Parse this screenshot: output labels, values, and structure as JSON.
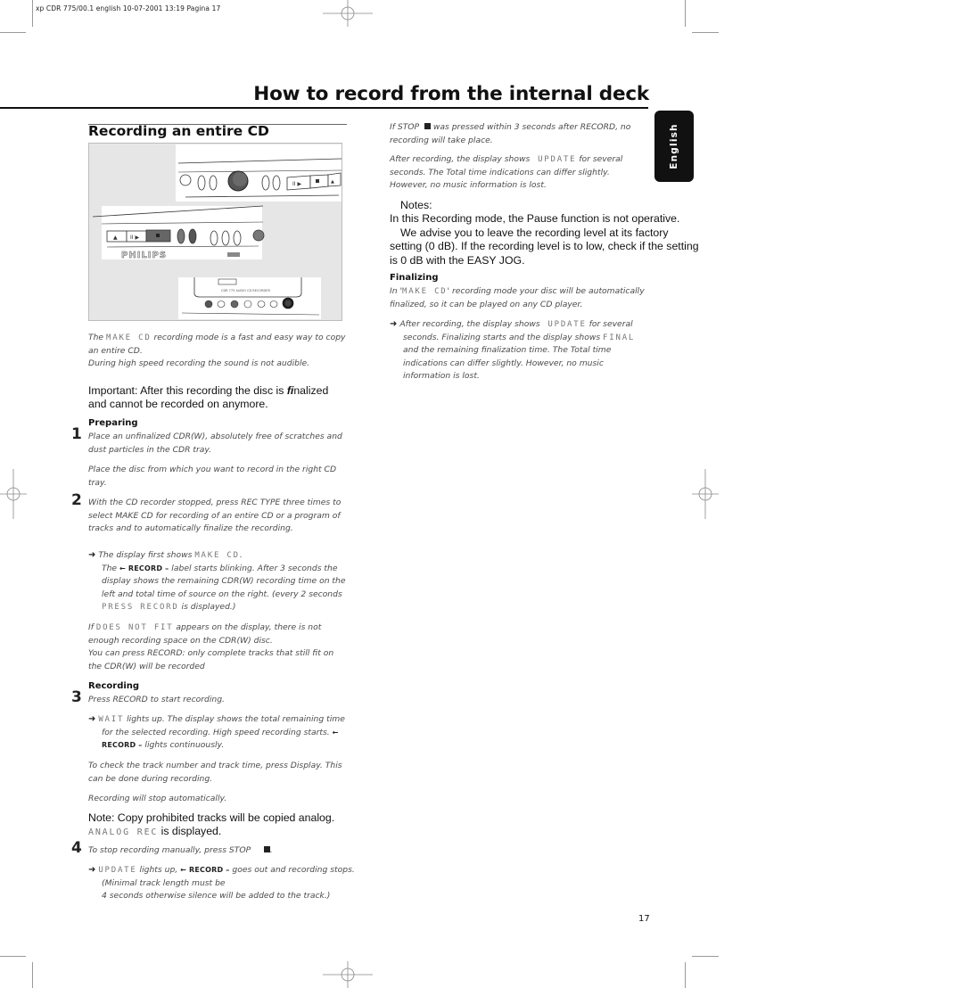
{
  "slug": "xp CDR 775/00.1 english   10-07-2001 13:19   Pagina 17",
  "page_title": "How to record from the internal deck",
  "section_title": "Recording an entire CD",
  "language_tab": "English",
  "page_number": "17",
  "illustration": {
    "label": "CD recorder front panel illustration",
    "brand": "PHILIPS"
  },
  "left_column": {
    "intro": {
      "pre": "The ",
      "lcd": "MAKE CD",
      "post": " recording mode is a fast and easy way to copy an entire CD.",
      "line2": "During high speed recording the sound is not audible."
    },
    "important": {
      "pre": "Important: After this recording the disc is ",
      "fi": "fi",
      "post": "nalized and cannot be recorded on anymore."
    },
    "preparing": {
      "heading": "Preparing",
      "step1_number": "1",
      "step1_text": "Place an unfinalized CDR(W), absolutely free of scratches and dust particles in the CDR tray.",
      "step1_text2": "Place the disc from which you want to record in the right CD tray.",
      "step2_number": "2",
      "step2_text": "With the CD recorder stopped, press REC TYPE three times to select MAKE CD for recording of an entire CD or a program of tracks and to automatically finalize the recording.",
      "result1_pre": "The display first shows ",
      "result1_lcd": "MAKE CD",
      "result1_post": ".",
      "result2_pre": "The ",
      "result2_badge": "← RECORD –",
      "result2_post": " label starts blinking. After 3 seconds the display shows the remaining CDR(W) recording time on the left and total time of source on the right. (every 2 seconds ",
      "result2_lcd": "PRESS RECORD",
      "result2_end": " is displayed.)",
      "fit_pre": "If ",
      "fit_lcd": "DOES NOT FIT",
      "fit_post": " appears on the display, there is not enough recording space on the CDR(W) disc.",
      "fit_line2": "You can press RECORD: only complete tracks that still fit on the CDR(W) will be recorded"
    },
    "recording": {
      "heading": "Recording",
      "step3_number": "3",
      "step3_text": "Press RECORD to start recording.",
      "result_lcd": "WAIT",
      "result_text": " lights up. The display shows the total remaining time for the selected recording. High speed recording starts. ",
      "result_badge": "← RECORD –",
      "result_end": " lights continuously.",
      "check": "To check the track number and track time, press Display. This can be done during recording.",
      "auto_stop": "Recording will stop automatically.",
      "note_line1": "Note: Copy prohibited tracks will be copied analog.",
      "note_lcd": "ANALOG REC",
      "note_line2": " is displayed.",
      "step4_number": "4",
      "step4_text": "To stop recording manually, press STOP",
      "step4_lcd": "UPDATE",
      "step4_text2": " lights up, ",
      "step4_badge": "← RECORD –",
      "step4_text3": " goes out and recording stops. (Minimal track length must be",
      "step4_text4": "4 seconds otherwise silence will be added to the track.)"
    }
  },
  "right_column": {
    "stop_note_pre": "If STOP ",
    "stop_note_post": " was pressed within 3 seconds after RECORD, no recording will take place.",
    "after_pre": "After recording, the display shows ",
    "after_lcd": "UPDATE",
    "after_post": " for several seconds. The Total time indications can differ slightly. However, no music information is lost.",
    "notes_heading": "Notes:",
    "notes_line1": "In this Recording mode, the Pause function is not operative.",
    "notes_line2": "We advise you to leave the recording level at its factory setting (0 dB). If the recording level is to low, check if the setting is 0 dB with the EASY JOG.",
    "finalizing": {
      "heading": "Finalizing",
      "text_pre": "In '",
      "text_lcd": "MAKE CD",
      "text_post": "' recording mode your disc will be automatically finalized, so it can be played on any CD player.",
      "result_pre": "After recording, the display shows ",
      "result_lcd": "UPDATE",
      "result_mid": " for several seconds. Finalizing starts and the display shows ",
      "result_lcd2": "FINAL",
      "result_post": " and the remaining finalization time. The Total time indications can differ slightly. However, no music information is lost."
    }
  }
}
